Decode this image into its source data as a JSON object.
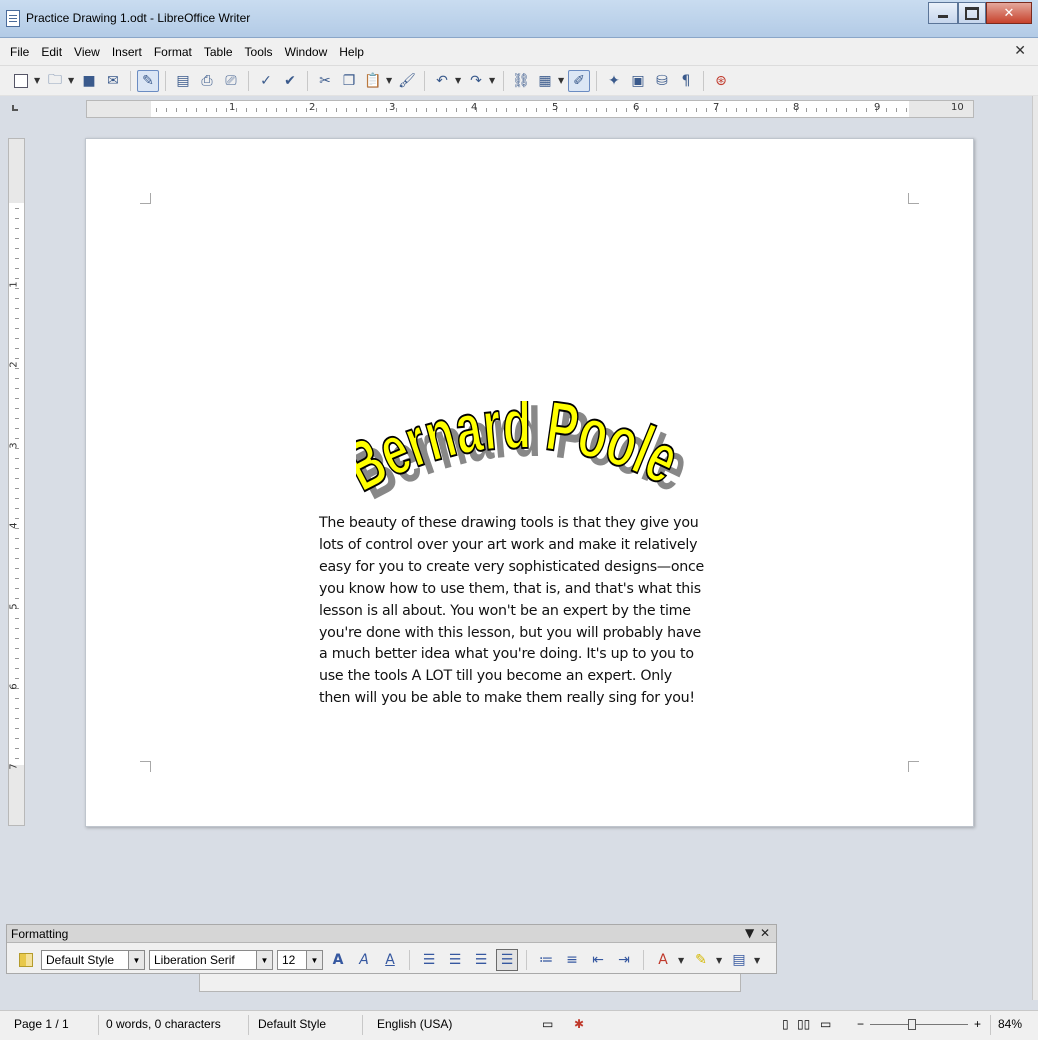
{
  "window": {
    "title": "Practice Drawing 1.odt - LibreOffice Writer"
  },
  "menu": [
    "File",
    "Edit",
    "View",
    "Insert",
    "Format",
    "Table",
    "Tools",
    "Window",
    "Help"
  ],
  "ruler": {
    "h_numbers": [
      "1",
      "2",
      "3",
      "4",
      "5",
      "6",
      "7",
      "8",
      "9",
      "10"
    ],
    "v_numbers": [
      "1",
      "2",
      "3",
      "4",
      "5",
      "6",
      "7"
    ]
  },
  "document": {
    "fontwork_text": "Bernard Poole",
    "fontwork_fill": "#ffff00",
    "fontwork_shadow": "#888888",
    "body_lines": [
      "The beauty of these drawing tools is that they give you",
      "lots of control over your art work and make it relatively",
      "easy for you to create very sophisticated designs—once",
      "you know how to use them, that is, and that's what this",
      "lesson is all about. You won't be an expert by the time",
      "you're done with this lesson, but you will probably have",
      "a much better idea what you're doing. It's up to you to",
      "use the tools A LOT till you become an expert. Only",
      "then will you be able to make them really sing for you!"
    ]
  },
  "formatting_toolbar": {
    "title": "Formatting",
    "paragraph_style": "Default Style",
    "font_name": "Liberation Serif",
    "font_size": "12"
  },
  "statusbar": {
    "page": "Page 1 / 1",
    "words": "0 words, 0 characters",
    "style": "Default Style",
    "language": "English (USA)",
    "zoom": "84%"
  }
}
